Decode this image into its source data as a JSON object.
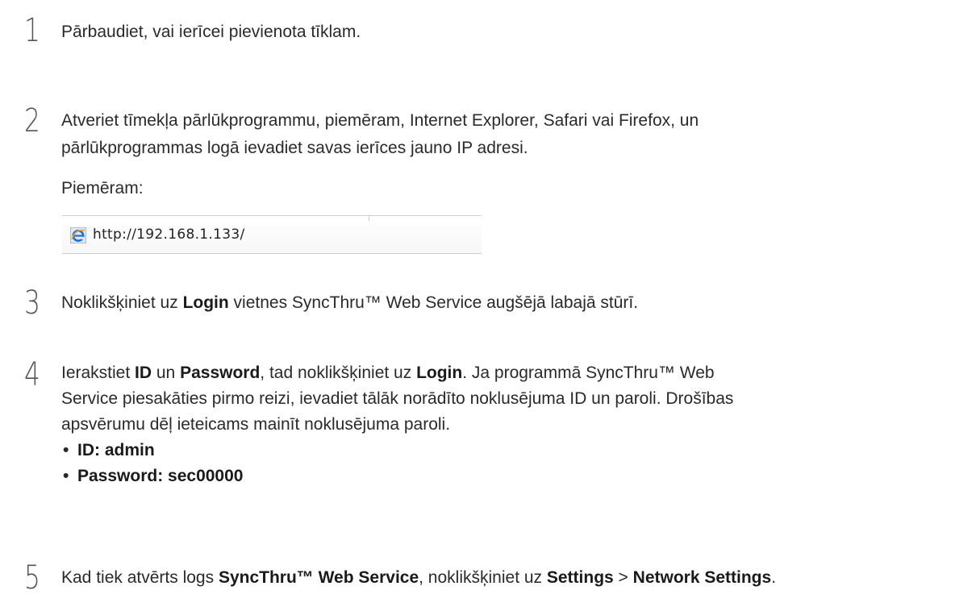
{
  "steps": [
    {
      "number": "1",
      "text": "Pārbaudiet, vai ierīcei pievienota tīklam."
    },
    {
      "number": "2",
      "line1": "Atveriet tīmekļa pārlūkprogrammu, piemēram, Internet Explorer, Safari vai Firefox, un",
      "line2": "pārlūkprogrammas logā ievadiet savas ierīces jauno IP adresi.",
      "example_label": "Piemēram:",
      "url": "http://192.168.1.133/"
    },
    {
      "number": "3",
      "pre": "Noklikšķiniet uz ",
      "bold": "Login",
      "post": " vietnes SyncThru™ Web Service augšējā labajā stūrī."
    },
    {
      "number": "4",
      "l1_pre": "Ierakstiet ",
      "l1_b1": "ID",
      "l1_mid1": " un ",
      "l1_b2": "Password",
      "l1_mid2": ", tad noklikšķiniet uz ",
      "l1_b3": "Login",
      "l1_post": ". Ja programmā SyncThru™ Web",
      "line2": "Service piesakāties pirmo reizi, ievadiet tālāk norādīto noklusējuma ID un paroli. Drošības",
      "line3": "apsvērumu dēļ ieteicams mainīt noklusējuma paroli.",
      "bullets": [
        "ID: admin",
        "Password: sec00000"
      ]
    },
    {
      "number": "5",
      "pre": "Kad tiek atvērts logs ",
      "b1": "SyncThru™ Web Service",
      "mid": ", noklikšķiniet uz ",
      "b2": "Settings",
      "sep": " > ",
      "b3": "Network Settings",
      "post": "."
    }
  ],
  "icons": {
    "browser": "internet-explorer-icon"
  }
}
